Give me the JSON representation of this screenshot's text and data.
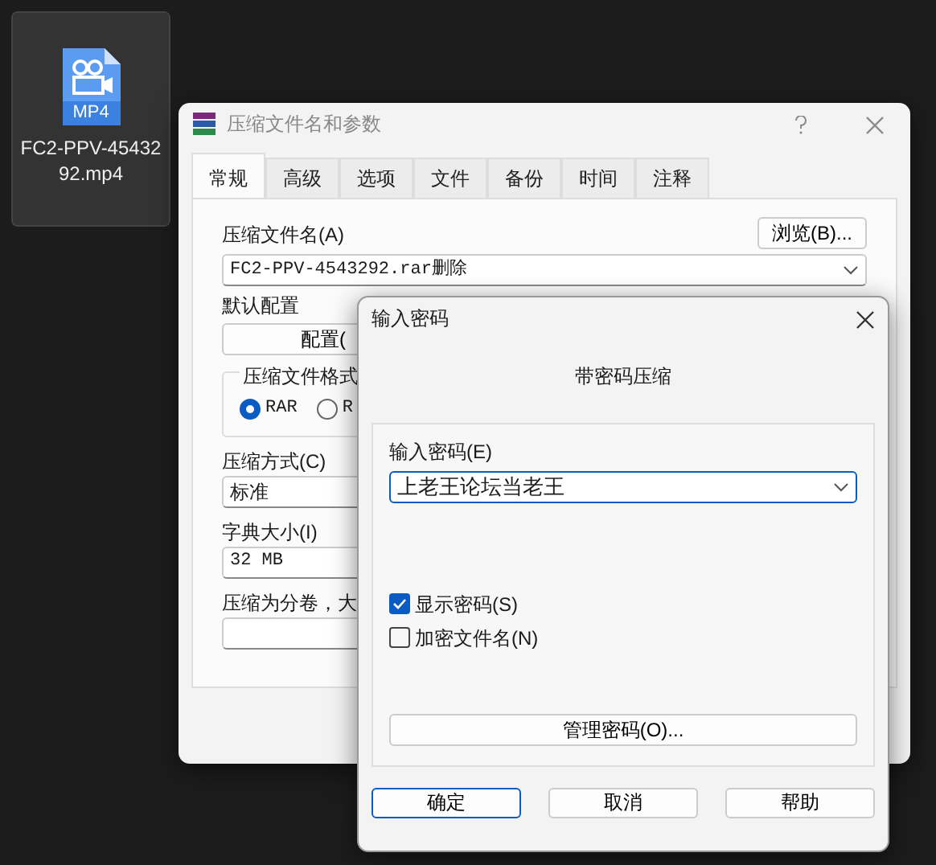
{
  "desktop_icon": {
    "badge": "MP4",
    "label": "FC2-PPV-4543292.mp4",
    "selected": true
  },
  "back_window": {
    "title": "压缩文件名和参数",
    "tabs": [
      {
        "label": "常规",
        "selected": true
      },
      {
        "label": "高级",
        "selected": false
      },
      {
        "label": "选项",
        "selected": false
      },
      {
        "label": "文件",
        "selected": false
      },
      {
        "label": "备份",
        "selected": false
      },
      {
        "label": "时间",
        "selected": false
      },
      {
        "label": "注释",
        "selected": false
      }
    ],
    "archive_name_label": "压缩文件名(A)",
    "browse_button": "浏览(B)...",
    "archive_name": "FC2-PPV-4543292.rar删除",
    "profile_label": "默认配置",
    "profile_button": "配置(",
    "format_group": "压缩文件格式",
    "format_options": [
      {
        "label": "RAR",
        "selected": true
      },
      {
        "label": "R",
        "selected": false
      }
    ],
    "method_label": "压缩方式(C)",
    "method_value": "标准",
    "dict_label": "字典大小(I)",
    "dict_value": "32 MB",
    "split_label": "压缩为分卷，大"
  },
  "dialog": {
    "title": "输入密码",
    "heading": "带密码压缩",
    "password_label": "输入密码(E)",
    "password_value": "上老王论坛当老王",
    "options": [
      {
        "label": "显示密码(S)",
        "checked": true
      },
      {
        "label": "加密文件名(N)",
        "checked": false
      }
    ],
    "manage_button": "管理密码(O)...",
    "buttons": [
      {
        "label": "确定",
        "default": true
      },
      {
        "label": "取消",
        "default": false
      },
      {
        "label": "帮助",
        "default": false
      }
    ]
  }
}
